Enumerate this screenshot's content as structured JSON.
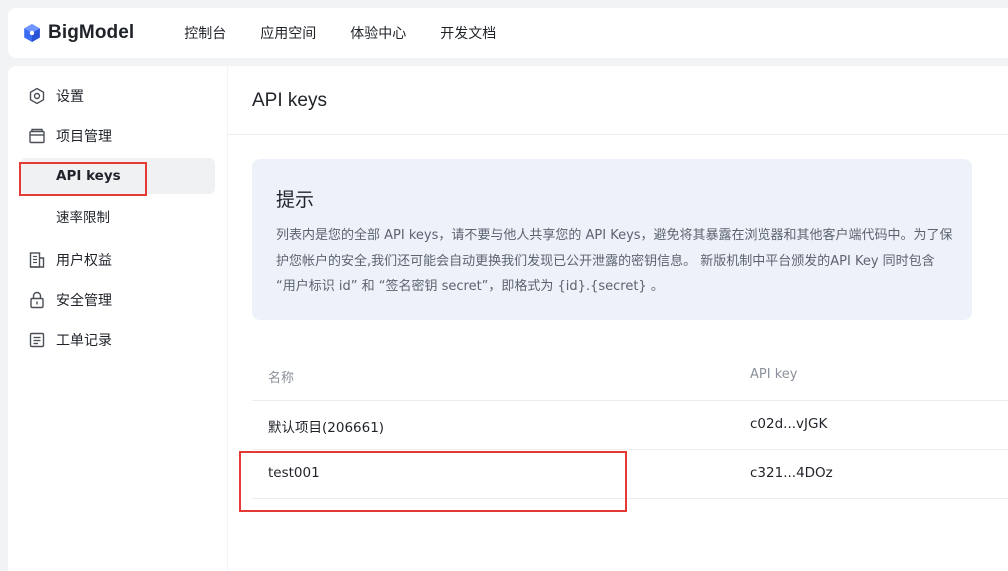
{
  "header": {
    "brand_name": "BigModel",
    "brand_icon": "bigmodel-logo",
    "nav": [
      {
        "label": "控制台"
      },
      {
        "label": "应用空间"
      },
      {
        "label": "体验中心"
      },
      {
        "label": "开发文档"
      }
    ]
  },
  "sidebar": {
    "items": [
      {
        "label": "设置",
        "icon": "gear-icon"
      },
      {
        "label": "项目管理",
        "icon": "folder-icon"
      },
      {
        "label": "API keys",
        "active": true
      },
      {
        "label": "速率限制"
      },
      {
        "label": "用户权益",
        "icon": "building-icon"
      },
      {
        "label": "安全管理",
        "icon": "lock-icon"
      },
      {
        "label": "工单记录",
        "icon": "ticket-icon"
      }
    ]
  },
  "main": {
    "title": "API keys",
    "notice": {
      "title": "提示",
      "body": "列表内是您的全部 API keys，请不要与他人共享您的 API Keys，避免将其暴露在浏览器和其他客户端代码中。为了保护您帐户的安全,我们还可能会自动更换我们发现已公开泄露的密钥信息。 新版机制中平台颁发的API Key 同时包含 “用户标识 id” 和 “签名密钥 secret”，即格式为 {id}.{secret} 。"
    },
    "table": {
      "headers": {
        "name": "名称",
        "key": "API key"
      },
      "rows": [
        {
          "name": "默认项目(206661)",
          "key": "c02d...vJGK"
        },
        {
          "name": "test001",
          "key": "c321...4DOz"
        }
      ]
    }
  },
  "colors": {
    "brand": "#3b6cf6",
    "highlight": "#e53935",
    "notice_bg": "#eef1f9"
  }
}
